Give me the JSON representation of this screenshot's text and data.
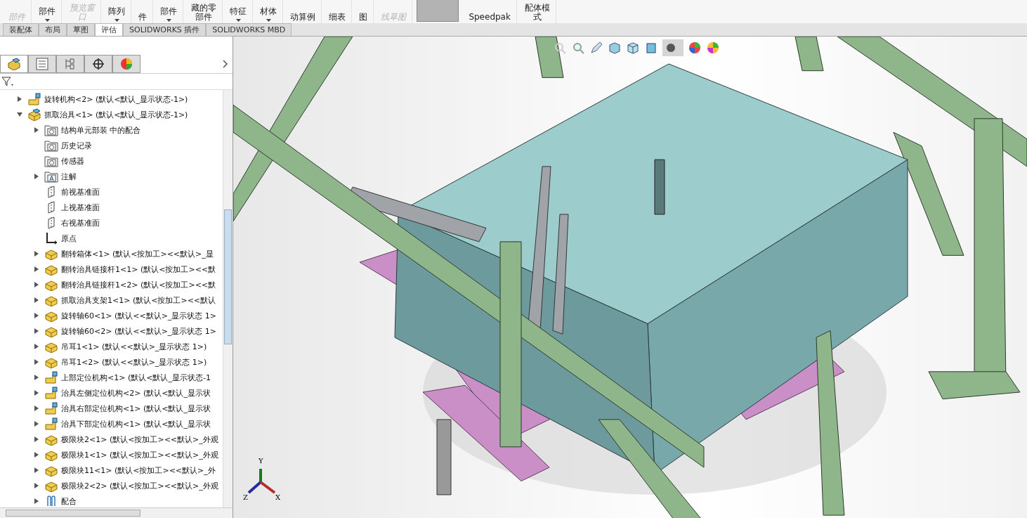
{
  "toolbar": {
    "items": [
      {
        "label": "部件",
        "disabled": true,
        "dropdown": false
      },
      {
        "label": "部件",
        "disabled": false,
        "dropdown": true
      },
      {
        "label": "预览窗口",
        "disabled": true,
        "dropdown": false
      },
      {
        "label": "阵列",
        "disabled": false,
        "dropdown": true
      },
      {
        "label": "件",
        "disabled": false,
        "dropdown": false
      },
      {
        "label": "部件",
        "disabled": false,
        "dropdown": true
      },
      {
        "label": "藏的零部件",
        "disabled": false,
        "dropdown": false
      },
      {
        "label": "特征",
        "disabled": false,
        "dropdown": true
      },
      {
        "label": "材体",
        "disabled": false,
        "dropdown": true
      },
      {
        "label": "动算例",
        "disabled": false,
        "dropdown": false
      },
      {
        "label": "细表",
        "disabled": false,
        "dropdown": false
      },
      {
        "label": "图",
        "disabled": false,
        "dropdown": false
      },
      {
        "label": "线草图",
        "disabled": true,
        "dropdown": false
      }
    ],
    "items_after": [
      {
        "label": "Speedpak",
        "disabled": false,
        "dropdown": false
      },
      {
        "label": "配体模式",
        "disabled": false,
        "dropdown": false
      }
    ]
  },
  "tabs": [
    {
      "label": "装配体",
      "selected": false
    },
    {
      "label": "布局",
      "selected": false
    },
    {
      "label": "草图",
      "selected": false
    },
    {
      "label": "评估",
      "selected": true
    },
    {
      "label": "SOLIDWORKS 插件",
      "selected": false
    },
    {
      "label": "SOLIDWORKS MBD",
      "selected": false
    }
  ],
  "panel_tabs": [
    {
      "kind": "feature",
      "selected": true
    },
    {
      "kind": "property",
      "selected": false
    },
    {
      "kind": "config",
      "selected": false
    },
    {
      "kind": "dim",
      "selected": false
    },
    {
      "kind": "display",
      "selected": false
    }
  ],
  "tree": [
    {
      "label": "旋转机构<2> (默认<默认_显示状态-1>)",
      "kind": "subassembly",
      "expandable": true,
      "expanded": false
    },
    {
      "label": "抓取治具<1> (默认<默认_显示状态-1>)",
      "kind": "assembly",
      "expandable": true,
      "expanded": true,
      "children": [
        {
          "label": "结构单元部装 中的配合",
          "kind": "mates-folder",
          "expandable": true,
          "expanded": false
        },
        {
          "label": "历史记录",
          "kind": "history",
          "expandable": false
        },
        {
          "label": "传感器",
          "kind": "sensor",
          "expandable": false
        },
        {
          "label": "注解",
          "kind": "annotation",
          "expandable": true,
          "expanded": false
        },
        {
          "label": "前视基准面",
          "kind": "plane",
          "expandable": false
        },
        {
          "label": "上视基准面",
          "kind": "plane",
          "expandable": false
        },
        {
          "label": "右视基准面",
          "kind": "plane",
          "expandable": false
        },
        {
          "label": "原点",
          "kind": "origin",
          "expandable": false
        },
        {
          "label": "翻转箱体<1> (默认<按加工><<默认>_显",
          "kind": "part",
          "expandable": true,
          "expanded": false
        },
        {
          "label": "翻转治具链接杆1<1> (默认<按加工><<默",
          "kind": "part",
          "expandable": true,
          "expanded": false
        },
        {
          "label": "翻转治具链接杆1<2> (默认<按加工><<默",
          "kind": "part",
          "expandable": true,
          "expanded": false
        },
        {
          "label": "抓取治具支架1<1> (默认<按加工><<默认",
          "kind": "part",
          "expandable": true,
          "expanded": false
        },
        {
          "label": "旋转轴60<1> (默认<<默认>_显示状态 1>",
          "kind": "part",
          "expandable": true,
          "expanded": false
        },
        {
          "label": "旋转轴60<2> (默认<<默认>_显示状态 1>",
          "kind": "part",
          "expandable": true,
          "expanded": false
        },
        {
          "label": "吊耳1<1> (默认<<默认>_显示状态 1>)",
          "kind": "part",
          "expandable": true,
          "expanded": false
        },
        {
          "label": "吊耳1<2> (默认<<默认>_显示状态 1>)",
          "kind": "part",
          "expandable": true,
          "expanded": false
        },
        {
          "label": "上部定位机构<1> (默认<默认_显示状态-1",
          "kind": "subassembly",
          "expandable": true,
          "expanded": false
        },
        {
          "label": "治具左侧定位机构<2> (默认<默认_显示状",
          "kind": "subassembly",
          "expandable": true,
          "expanded": false
        },
        {
          "label": "治具右部定位机构<1> (默认<默认_显示状",
          "kind": "subassembly",
          "expandable": true,
          "expanded": false
        },
        {
          "label": "治具下部定位机构<1> (默认<默认_显示状",
          "kind": "subassembly",
          "expandable": true,
          "expanded": false
        },
        {
          "label": "极限块2<1> (默认<按加工><<默认>_外观",
          "kind": "part",
          "expandable": true,
          "expanded": false
        },
        {
          "label": "极限块1<1> (默认<按加工><<默认>_外观",
          "kind": "part",
          "expandable": true,
          "expanded": false
        },
        {
          "label": "极限块11<1> (默认<按加工><<默认>_外",
          "kind": "part",
          "expandable": true,
          "expanded": false
        },
        {
          "label": "极限块2<2> (默认<按加工><<默认>_外观",
          "kind": "part",
          "expandable": true,
          "expanded": false
        },
        {
          "label": "配合",
          "kind": "mates",
          "expandable": true,
          "expanded": false
        }
      ]
    }
  ],
  "triad": {
    "x": "X",
    "y": "Y",
    "z": "Z"
  }
}
